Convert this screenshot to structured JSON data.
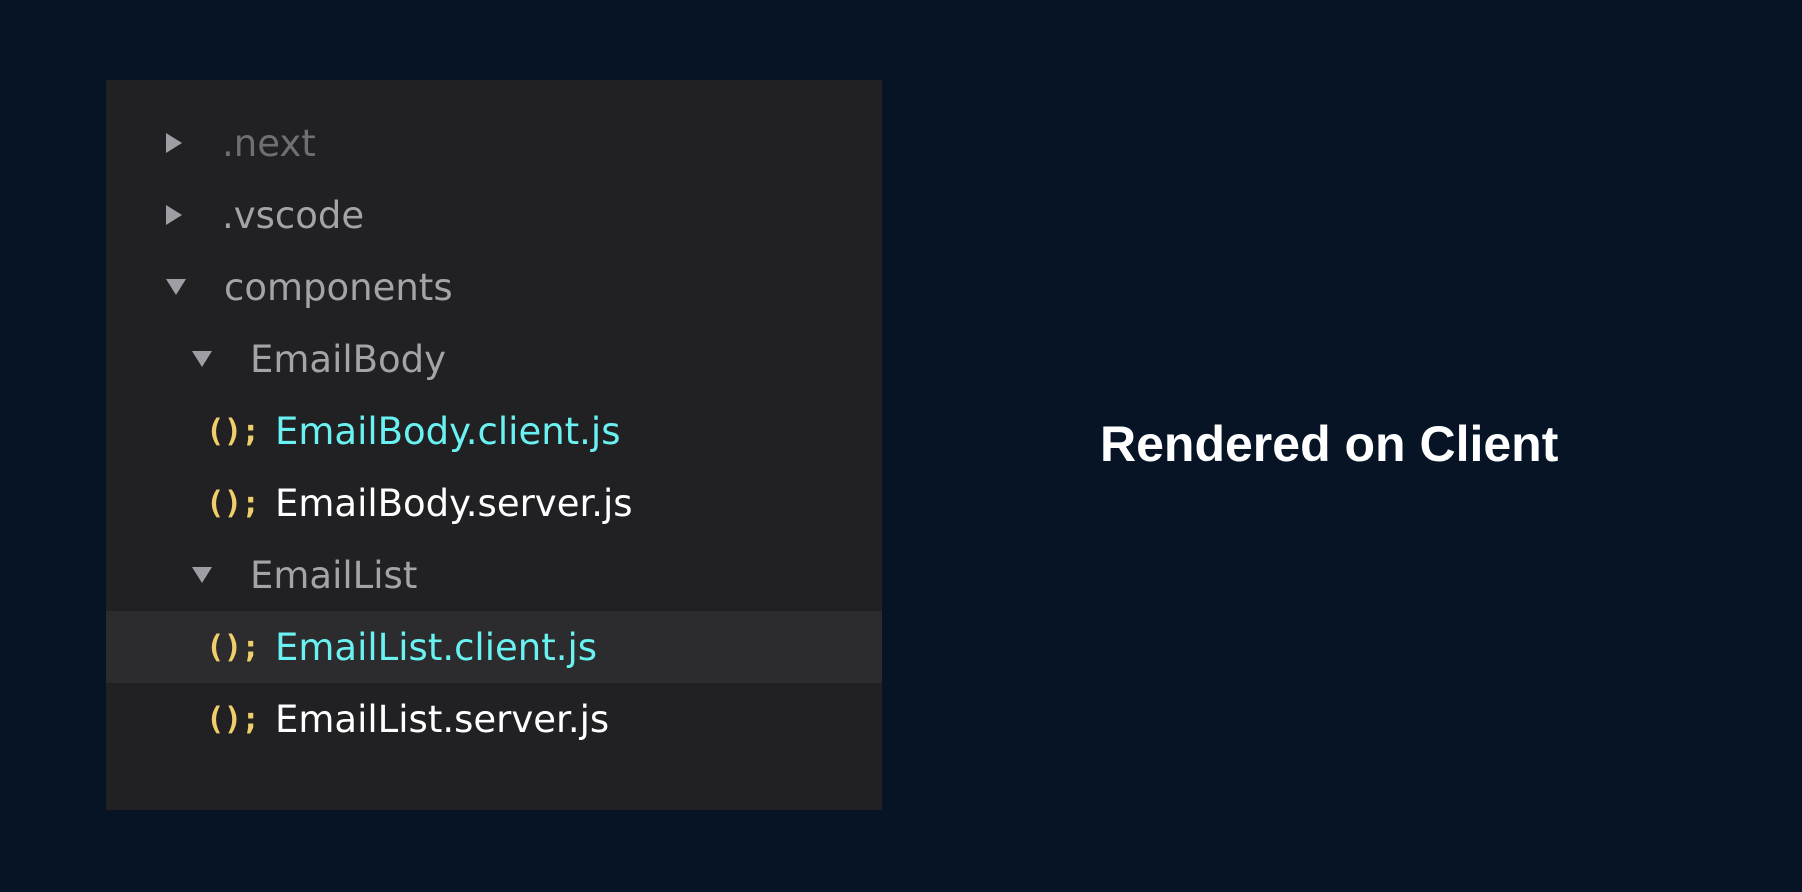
{
  "explorer": {
    "items": [
      {
        "label": ".next",
        "type": "folder",
        "state": "collapsed",
        "icon": "caret-right-icon"
      },
      {
        "label": ".vscode",
        "type": "folder",
        "state": "collapsed",
        "icon": "caret-right-icon"
      },
      {
        "label": "components",
        "type": "folder",
        "state": "expanded",
        "icon": "caret-down-icon"
      },
      {
        "label": "EmailBody",
        "type": "folder",
        "state": "expanded",
        "icon": "caret-down-icon"
      },
      {
        "label": "EmailBody.client.js",
        "type": "file",
        "icon": "js-file-icon",
        "icon_glyph": "();"
      },
      {
        "label": "EmailBody.server.js",
        "type": "file",
        "icon": "js-file-icon",
        "icon_glyph": "();"
      },
      {
        "label": "EmailList",
        "type": "folder",
        "state": "expanded",
        "icon": "caret-down-icon"
      },
      {
        "label": "EmailList.client.js",
        "type": "file",
        "icon": "js-file-icon",
        "icon_glyph": "();",
        "highlighted": true
      },
      {
        "label": "EmailList.server.js",
        "type": "file",
        "icon": "js-file-icon",
        "icon_glyph": "();"
      }
    ]
  },
  "caption": "Rendered on Client",
  "colors": {
    "background": "#061425",
    "panel": "#212023",
    "highlight_row": "#2c2b2e",
    "folder_text": "#a3a3a8",
    "client_file": "#6af2f2",
    "server_file": "#ffffff",
    "js_icon": "#f0cf6a"
  }
}
